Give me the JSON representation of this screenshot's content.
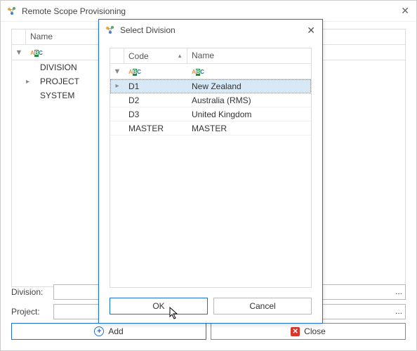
{
  "main": {
    "title": "Remote Scope Provisioning",
    "grid": {
      "columns": [
        "Name"
      ],
      "rows": [
        {
          "label": "DIVISION",
          "expand": ""
        },
        {
          "label": "PROJECT",
          "expand": "▸"
        },
        {
          "label": "SYSTEM",
          "expand": ""
        }
      ]
    },
    "fields": {
      "division": {
        "label": "Division:",
        "value": "",
        "dots": "..."
      },
      "project": {
        "label": "Project:",
        "value": "",
        "dots": "..."
      }
    },
    "buttons": {
      "add": "Add",
      "close": "Close"
    }
  },
  "modal": {
    "title": "Select Division",
    "columns": {
      "code": "Code",
      "name": "Name"
    },
    "rows": [
      {
        "code": "D1",
        "name": "New Zealand",
        "selected": true,
        "expand": "▸"
      },
      {
        "code": "D2",
        "name": "Australia (RMS)",
        "selected": false,
        "expand": ""
      },
      {
        "code": "D3",
        "name": "United Kingdom",
        "selected": false,
        "expand": ""
      },
      {
        "code": "MASTER",
        "name": "MASTER",
        "selected": false,
        "expand": ""
      }
    ],
    "buttons": {
      "ok": "OK",
      "cancel": "Cancel"
    }
  }
}
